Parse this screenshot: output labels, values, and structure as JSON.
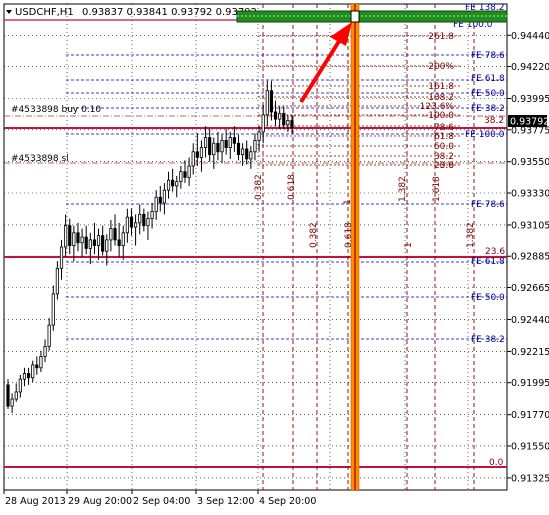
{
  "header": {
    "symbol": "USDCHF,H1",
    "ohlc": "0.93837 0.93841 0.93792 0.93792"
  },
  "chart_data": {
    "type": "candlestick",
    "symbol": "USDCHF",
    "timeframe": "H1",
    "ylim": [
      0.9124,
      0.9466
    ],
    "y_ticks": [
      0.9444,
      0.9422,
      0.93995,
      0.93775,
      0.9355,
      0.9333,
      0.93105,
      0.92885,
      0.92665,
      0.9244,
      0.92215,
      0.91995,
      0.9177,
      0.9155,
      0.91325
    ],
    "y_tick_labels": [
      "0.94440",
      "0.94220",
      "0.93995",
      "0.93775",
      "0.93550",
      "0.93330",
      "0.93105",
      "0.92885",
      "0.92665",
      "0.92440",
      "0.92215",
      "0.91995",
      "0.91770",
      "0.91550",
      "0.91325"
    ],
    "current_price": 0.93792,
    "current_price_label": "0.93792",
    "x_tick_labels": [
      "28 Aug 2013",
      "29 Aug 20:00",
      "2 Sep 04:00",
      "3 Sep 12:00",
      "4 Sep 20:00"
    ],
    "order_labels": [
      "#4533898 buy 0.10",
      "#4533898 sl"
    ],
    "fibo_expansion_labels": [
      "261.8",
      "200%",
      "161.8",
      "138.2",
      "123.6%",
      "100.0",
      "78.6",
      "61.8",
      "50.0",
      "38.2",
      "23.6",
      "0.0"
    ],
    "fe_labels_right": [
      "FE 78.6",
      "FE 61.8",
      "FE 50.0",
      "FE 38.2",
      "FE 100.0",
      "FE 78.6",
      "FE 61.8",
      "FE 50.0",
      "FE 38.2",
      "FE 138.2",
      "FE 100.0"
    ],
    "fibo_right_levels": [
      "38.2",
      "23.6",
      "0.0",
      "50.0",
      "30.0"
    ],
    "time_zone_labels": [
      "0.382",
      "0.618",
      "1",
      "1.382",
      "1.618",
      "0.382",
      "0.618",
      "1",
      "1.382"
    ],
    "highlighted_time_zone": "1",
    "colors": {
      "bull": "#ffffff",
      "bear": "#000000",
      "candle_outline": "#000000",
      "grid": "#000000",
      "fibo": "#800000",
      "fe": "#0000a0",
      "level_line": "#c0143c",
      "time_zone_highlight": "#ff8c00",
      "arrow": "#ff0000",
      "top_band": "#228b22"
    },
    "candles": [
      [
        0.9198,
        0.9202,
        0.9181,
        0.9183
      ],
      [
        0.9183,
        0.9192,
        0.9178,
        0.9188
      ],
      [
        0.9188,
        0.9199,
        0.9186,
        0.9193
      ],
      [
        0.9193,
        0.9205,
        0.9189,
        0.9202
      ],
      [
        0.9202,
        0.921,
        0.9197,
        0.9206
      ],
      [
        0.9206,
        0.921,
        0.9198,
        0.9203
      ],
      [
        0.9203,
        0.9215,
        0.92,
        0.9212
      ],
      [
        0.9212,
        0.9218,
        0.9205,
        0.921
      ],
      [
        0.921,
        0.9222,
        0.9207,
        0.9218
      ],
      [
        0.9218,
        0.923,
        0.9214,
        0.9225
      ],
      [
        0.9225,
        0.9245,
        0.9222,
        0.924
      ],
      [
        0.924,
        0.9268,
        0.9236,
        0.9262
      ],
      [
        0.9262,
        0.9285,
        0.9258,
        0.928
      ],
      [
        0.928,
        0.93,
        0.9272,
        0.9295
      ],
      [
        0.9295,
        0.9318,
        0.9288,
        0.931
      ],
      [
        0.931,
        0.9315,
        0.929,
        0.9296
      ],
      [
        0.9296,
        0.931,
        0.9285,
        0.9305
      ],
      [
        0.9305,
        0.9312,
        0.9292,
        0.9298
      ],
      [
        0.9298,
        0.9308,
        0.9288,
        0.9302
      ],
      [
        0.9302,
        0.931,
        0.929,
        0.9294
      ],
      [
        0.9294,
        0.9305,
        0.9283,
        0.93
      ],
      [
        0.93,
        0.9312,
        0.929,
        0.9296
      ],
      [
        0.9296,
        0.9308,
        0.9286,
        0.9303
      ],
      [
        0.9303,
        0.931,
        0.9289,
        0.9292
      ],
      [
        0.9292,
        0.9304,
        0.9282,
        0.93
      ],
      [
        0.93,
        0.9314,
        0.9292,
        0.9308
      ],
      [
        0.9308,
        0.9318,
        0.9296,
        0.93
      ],
      [
        0.93,
        0.9312,
        0.9288,
        0.9296
      ],
      [
        0.9296,
        0.931,
        0.9286,
        0.9305
      ],
      [
        0.9305,
        0.9322,
        0.9298,
        0.9316
      ],
      [
        0.9316,
        0.9322,
        0.9303,
        0.9309
      ],
      [
        0.9309,
        0.9318,
        0.9296,
        0.9312
      ],
      [
        0.9312,
        0.9325,
        0.9304,
        0.9318
      ],
      [
        0.9318,
        0.9322,
        0.9306,
        0.931
      ],
      [
        0.931,
        0.932,
        0.93,
        0.9315
      ],
      [
        0.9315,
        0.9326,
        0.9308,
        0.932
      ],
      [
        0.932,
        0.9335,
        0.9314,
        0.933
      ],
      [
        0.933,
        0.9338,
        0.932,
        0.9326
      ],
      [
        0.9326,
        0.934,
        0.9318,
        0.9335
      ],
      [
        0.9335,
        0.9348,
        0.9329,
        0.9342
      ],
      [
        0.9342,
        0.935,
        0.9334,
        0.9338
      ],
      [
        0.9338,
        0.9345,
        0.933,
        0.9341
      ],
      [
        0.9341,
        0.9352,
        0.9336,
        0.9348
      ],
      [
        0.9348,
        0.9356,
        0.934,
        0.9344
      ],
      [
        0.9344,
        0.9358,
        0.9338,
        0.9352
      ],
      [
        0.9352,
        0.9368,
        0.9346,
        0.9362
      ],
      [
        0.9362,
        0.9375,
        0.9352,
        0.9358
      ],
      [
        0.9358,
        0.937,
        0.9348,
        0.9365
      ],
      [
        0.9365,
        0.938,
        0.9358,
        0.9372
      ],
      [
        0.9372,
        0.9378,
        0.9355,
        0.936
      ],
      [
        0.936,
        0.9372,
        0.935,
        0.9368
      ],
      [
        0.9368,
        0.9376,
        0.9356,
        0.9362
      ],
      [
        0.9362,
        0.9374,
        0.9354,
        0.937
      ],
      [
        0.937,
        0.9378,
        0.936,
        0.9365
      ],
      [
        0.9365,
        0.9376,
        0.9357,
        0.9372
      ],
      [
        0.9372,
        0.938,
        0.9362,
        0.9368
      ],
      [
        0.9368,
        0.9374,
        0.9356,
        0.936
      ],
      [
        0.936,
        0.9368,
        0.9352,
        0.9364
      ],
      [
        0.9364,
        0.937,
        0.9353,
        0.9357
      ],
      [
        0.9357,
        0.9366,
        0.935,
        0.9362
      ],
      [
        0.9362,
        0.9375,
        0.9356,
        0.937
      ],
      [
        0.937,
        0.938,
        0.9362,
        0.9376
      ],
      [
        0.9376,
        0.9395,
        0.9368,
        0.9388
      ],
      [
        0.9388,
        0.9412,
        0.938,
        0.9405
      ],
      [
        0.9405,
        0.9412,
        0.9384,
        0.939
      ],
      [
        0.939,
        0.9398,
        0.938,
        0.9385
      ],
      [
        0.9385,
        0.9394,
        0.9378,
        0.9389
      ],
      [
        0.9389,
        0.9394,
        0.9378,
        0.9381
      ],
      [
        0.9381,
        0.9388,
        0.9376,
        0.9384
      ],
      [
        0.9384,
        0.9388,
        0.9375,
        0.93792
      ]
    ]
  }
}
